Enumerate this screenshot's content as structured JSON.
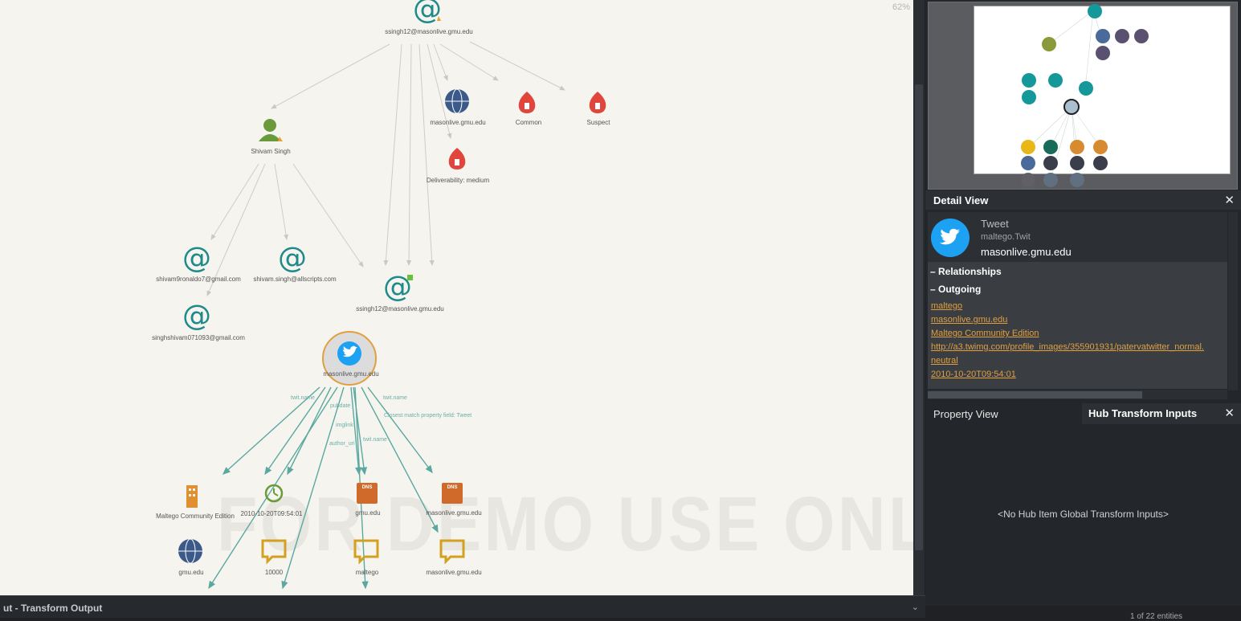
{
  "graph": {
    "zoom": "62%",
    "watermark": "FOR DEMO USE ONLY",
    "nodes": {
      "email_top": "ssingh12@masonlive.gmu.edu",
      "person": "Shivam Singh",
      "domain_top": "masonlive.gmu.edu",
      "common": "Common",
      "suspect": "Suspect",
      "deliverability": "Deliverability: medium",
      "email_a": "shivam9ronaldo7@gmail.com",
      "email_b": "shivam.singh@allscripts.com",
      "email_c": "singhshivam071093@gmail.com",
      "email_mid": "ssingh12@masonlive.gmu.edu",
      "tweet": "masonlive.gmu.edu",
      "company": "Maltego Community Edition",
      "datetime": "2010-10-20T09:54:01",
      "dns1": "gmu.edu",
      "dns2": "masonlive.gmu.edu",
      "domain_bottom": "gmu.edu",
      "phrase1": "10000",
      "phrase2": "maltego",
      "phrase3": "masonlive.gmu.edu"
    },
    "edge_labels": {
      "e1": "twit.name",
      "e2": "pubdate",
      "e3": "imglink",
      "e4": "author_uri",
      "e5": "twit.name",
      "e6": "twit.name",
      "e7": "Closest match property field: Tweet"
    }
  },
  "bottom_bar": {
    "tabs": "ut - Transform Output",
    "collapse": "⌄"
  },
  "detail_view": {
    "title": "Detail View",
    "close": "✕",
    "entity_type": "Tweet",
    "entity_class": "maltego.Twit",
    "entity_value": "masonlive.gmu.edu",
    "relationships_label": "– Relationships",
    "outgoing_label": "– Outgoing",
    "links": [
      "maltego",
      "masonlive.gmu.edu",
      "Maltego Community Edition",
      "http://a3.twimg.com/profile_images/355901931/patervatwitter_normal.",
      "neutral",
      "2010-10-20T09:54:01"
    ]
  },
  "tabs": {
    "property_view": "Property View",
    "hub_inputs": "Hub Transform Inputs",
    "close": "✕"
  },
  "hub_message": "<No Hub Item Global Transform Inputs>",
  "status": "1 of 22 entities",
  "colors": {
    "canvas": "#f6f4ef",
    "email_teal": "#1f8a8a",
    "tweet_blue": "#1da1f2",
    "edge_teal": "#5aa89f",
    "link_orange": "#e0a040"
  }
}
